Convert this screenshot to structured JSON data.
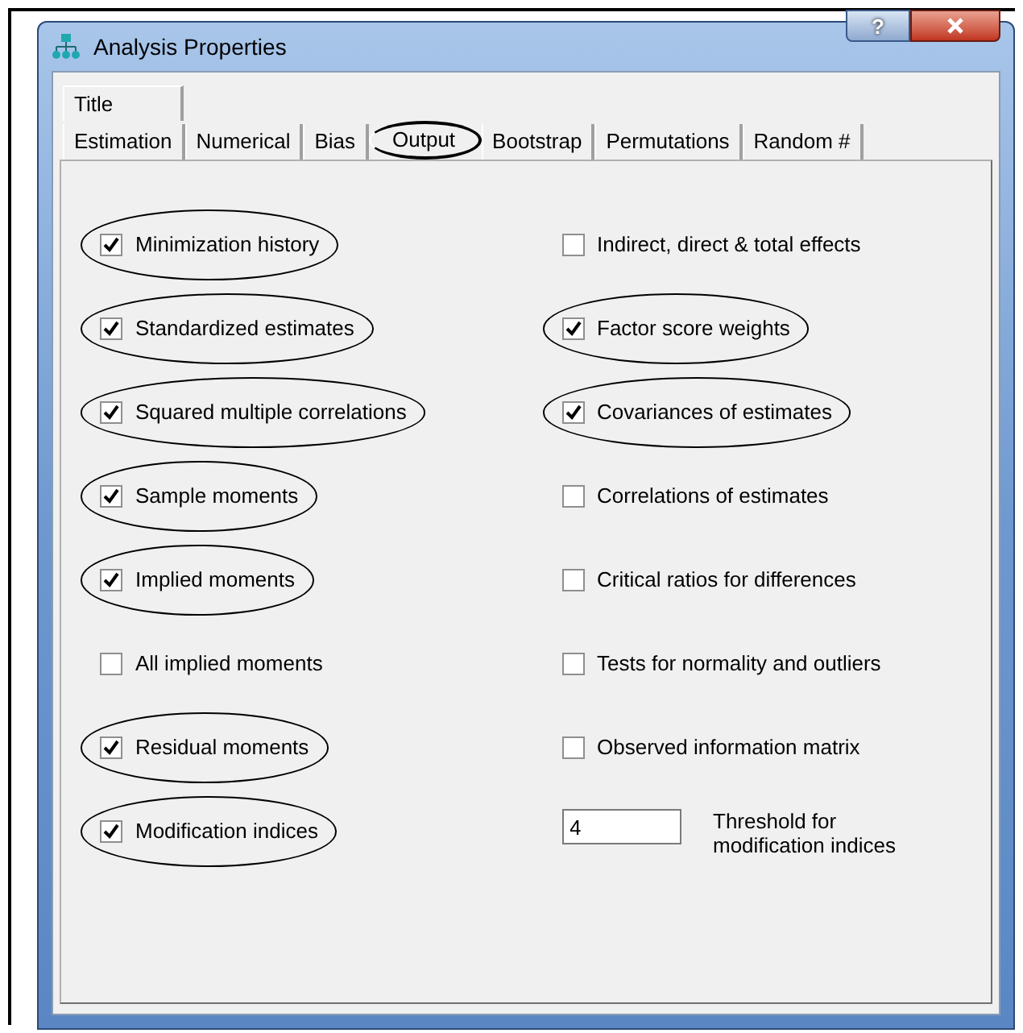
{
  "window": {
    "title": "Analysis Properties",
    "help_button": "?"
  },
  "tabs": {
    "rows": [
      [
        {
          "label": "Title",
          "selected": false,
          "circled": false
        }
      ],
      [
        {
          "label": "Estimation",
          "selected": false,
          "circled": false
        },
        {
          "label": "Numerical",
          "selected": false,
          "circled": false
        },
        {
          "label": "Bias",
          "selected": false,
          "circled": false
        },
        {
          "label": "Output",
          "selected": true,
          "circled": true
        },
        {
          "label": "Bootstrap",
          "selected": false,
          "circled": false
        },
        {
          "label": "Permutations",
          "selected": false,
          "circled": false
        },
        {
          "label": "Random #",
          "selected": false,
          "circled": false
        }
      ]
    ]
  },
  "left_options": [
    {
      "kind": "checkbox",
      "label": "Minimization history",
      "checked": true,
      "circled": true
    },
    {
      "kind": "checkbox",
      "label": "Standardized estimates",
      "checked": true,
      "circled": true
    },
    {
      "kind": "checkbox",
      "label": "Squared multiple correlations",
      "checked": true,
      "circled": true
    },
    {
      "kind": "checkbox",
      "label": "Sample moments",
      "checked": true,
      "circled": true
    },
    {
      "kind": "checkbox",
      "label": "Implied moments",
      "checked": true,
      "circled": true
    },
    {
      "kind": "checkbox",
      "label": "All implied moments",
      "checked": false,
      "circled": false
    },
    {
      "kind": "checkbox",
      "label": "Residual moments",
      "checked": true,
      "circled": true
    },
    {
      "kind": "checkbox",
      "label": "Modification indices",
      "checked": true,
      "circled": true
    }
  ],
  "right_options": [
    {
      "kind": "checkbox",
      "label": "Indirect, direct & total effects",
      "checked": false,
      "circled": false
    },
    {
      "kind": "checkbox",
      "label": "Factor score weights",
      "checked": true,
      "circled": true
    },
    {
      "kind": "checkbox",
      "label": "Covariances of estimates",
      "checked": true,
      "circled": true
    },
    {
      "kind": "checkbox",
      "label": "Correlations of estimates",
      "checked": false,
      "circled": false
    },
    {
      "kind": "checkbox",
      "label": "Critical ratios for differences",
      "checked": false,
      "circled": false
    },
    {
      "kind": "checkbox",
      "label": "Tests for normality and outliers",
      "checked": false,
      "circled": false
    },
    {
      "kind": "checkbox",
      "label": "Observed information matrix",
      "checked": false,
      "circled": false
    },
    {
      "kind": "field",
      "value": "4",
      "label_lines": [
        "Threshold for",
        "modification indices"
      ],
      "circled": false
    }
  ]
}
